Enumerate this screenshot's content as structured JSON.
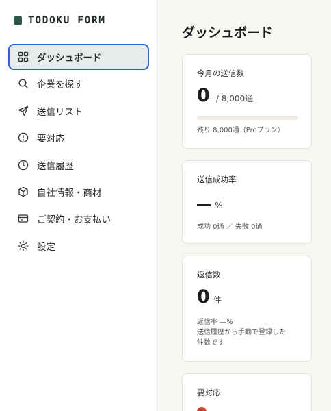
{
  "app": {
    "brand": "TODOKU FORM"
  },
  "sidebar": {
    "items": [
      {
        "label": "ダッシュボード",
        "icon": "grid-icon",
        "active": true
      },
      {
        "label": "企業を探す",
        "icon": "search-icon"
      },
      {
        "label": "送信リスト",
        "icon": "send-icon"
      },
      {
        "label": "要対応",
        "icon": "alert-circle-icon"
      },
      {
        "label": "送信履歴",
        "icon": "clock-icon"
      },
      {
        "label": "自社情報・商材",
        "icon": "box-icon"
      },
      {
        "label": "ご契約・お支払い",
        "icon": "card-icon"
      },
      {
        "label": "設定",
        "icon": "gear-icon"
      }
    ]
  },
  "main": {
    "title": "ダッシュボード",
    "monthly": {
      "label": "今月の送信数",
      "value": "0",
      "limit": "/ 8,000通",
      "progress": 0,
      "remaining": "残り 8,000通（Proプラン）"
    },
    "success": {
      "label": "送信成功率",
      "unit": "%",
      "detail": "成功 0通 ／ 失敗 0通"
    },
    "replies": {
      "label": "返信数",
      "value": "0",
      "unit": "件",
      "rate": "返信率 —%",
      "note1": "送信履歴から手動で登録した",
      "note2": "件数です"
    },
    "pending": {
      "label": "要対応"
    }
  },
  "colors": {
    "accent": "#2f5747",
    "active_border": "#2f64c8",
    "active_bg": "#e7ece8",
    "alert": "#c9472f"
  }
}
